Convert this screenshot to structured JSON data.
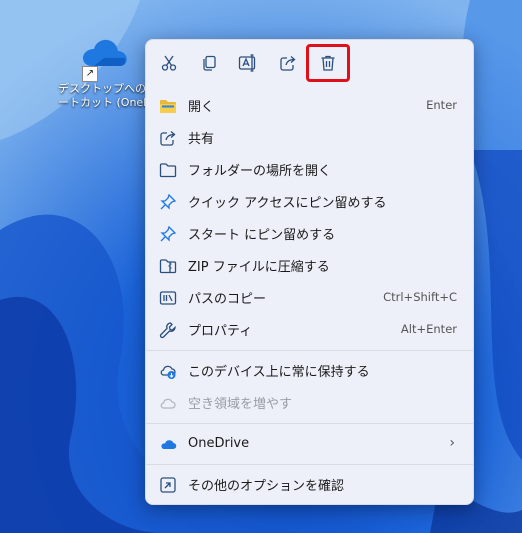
{
  "desktop": {
    "shortcut_label_line1": "デスクトップへのショ",
    "shortcut_label_line2": "ートカット (OneDri"
  },
  "toolbar": {
    "buttons": [
      {
        "name": "cut-icon"
      },
      {
        "name": "copy-icon"
      },
      {
        "name": "rename-icon"
      },
      {
        "name": "share-icon"
      },
      {
        "name": "delete-icon"
      }
    ]
  },
  "menu": {
    "open": {
      "label": "開く",
      "shortcut": "Enter"
    },
    "share": {
      "label": "共有"
    },
    "open_location": {
      "label": "フォルダーの場所を開く"
    },
    "pin_quick": {
      "label": "クイック アクセスにピン留めする"
    },
    "pin_start": {
      "label": "スタート にピン留めする"
    },
    "zip": {
      "label": "ZIP ファイルに圧縮する"
    },
    "copy_path": {
      "label": "パスのコピー",
      "shortcut": "Ctrl+Shift+C"
    },
    "properties": {
      "label": "プロパティ",
      "shortcut": "Alt+Enter"
    },
    "keep_device": {
      "label": "このデバイス上に常に保持する"
    },
    "free_space": {
      "label": "空き領域を増やす"
    },
    "onedrive": {
      "label": "OneDrive"
    },
    "more_options": {
      "label": "その他のオプションを確認"
    }
  }
}
